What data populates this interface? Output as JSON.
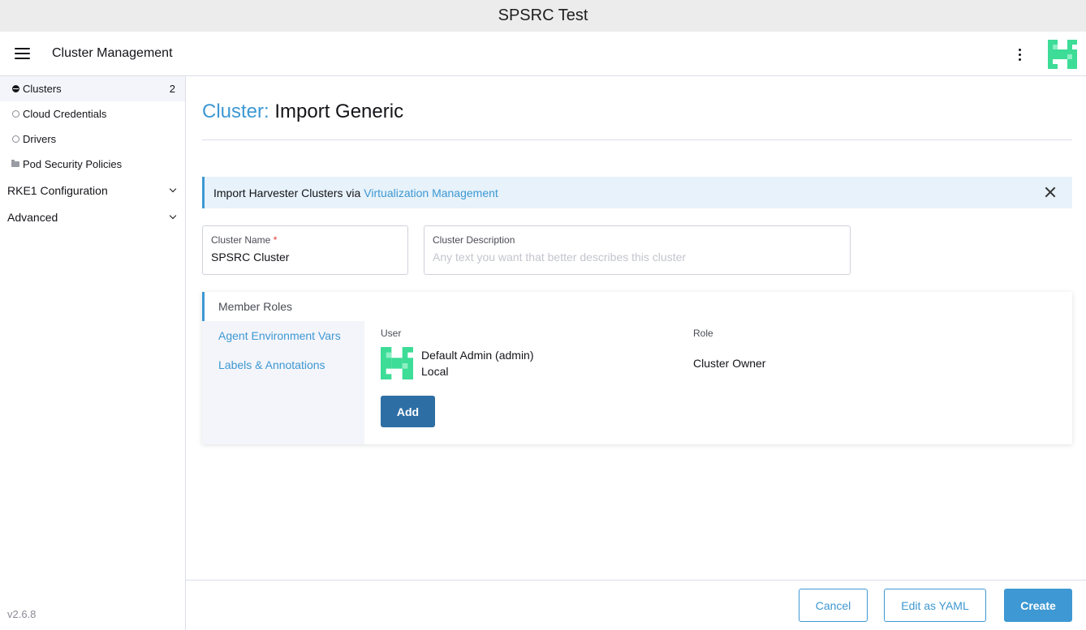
{
  "window": {
    "title": "SPSRC Test"
  },
  "header": {
    "title": "Cluster Management"
  },
  "sidebar": {
    "items": [
      {
        "label": "Clusters",
        "count": "2"
      },
      {
        "label": "Cloud Credentials"
      },
      {
        "label": "Drivers"
      },
      {
        "label": "Pod Security Policies"
      }
    ],
    "groups": [
      {
        "label": "RKE1 Configuration"
      },
      {
        "label": "Advanced"
      }
    ],
    "version": "v2.6.8"
  },
  "page": {
    "title_prefix": "Cluster:",
    "title": "Import Generic"
  },
  "banner": {
    "text": "Import Harvester Clusters via",
    "link": "Virtualization Management"
  },
  "form": {
    "name_label": "Cluster Name",
    "name_required": "*",
    "name_value": "SPSRC Cluster",
    "desc_label": "Cluster Description",
    "desc_placeholder": "Any text you want that better describes this cluster"
  },
  "roles": {
    "tabs": [
      "Member Roles",
      "Agent Environment Vars",
      "Labels & Annotations"
    ],
    "user_header": "User",
    "role_header": "Role",
    "member": {
      "name": "Default Admin (admin)",
      "provider": "Local",
      "role": "Cluster Owner"
    },
    "add_label": "Add"
  },
  "footer": {
    "cancel": "Cancel",
    "edit_yaml": "Edit as YAML",
    "create": "Create"
  },
  "colors": {
    "accent": "#3d98d3",
    "primary_dark": "#2d6fa5",
    "banner_bg": "#e7f2fa",
    "logo_green": "#3ddc97"
  },
  "icons": [
    "menu-icon",
    "globe-icon",
    "folder-icon",
    "chevron-down-icon",
    "close-icon",
    "kebab-menu-icon",
    "harvester-logo"
  ]
}
